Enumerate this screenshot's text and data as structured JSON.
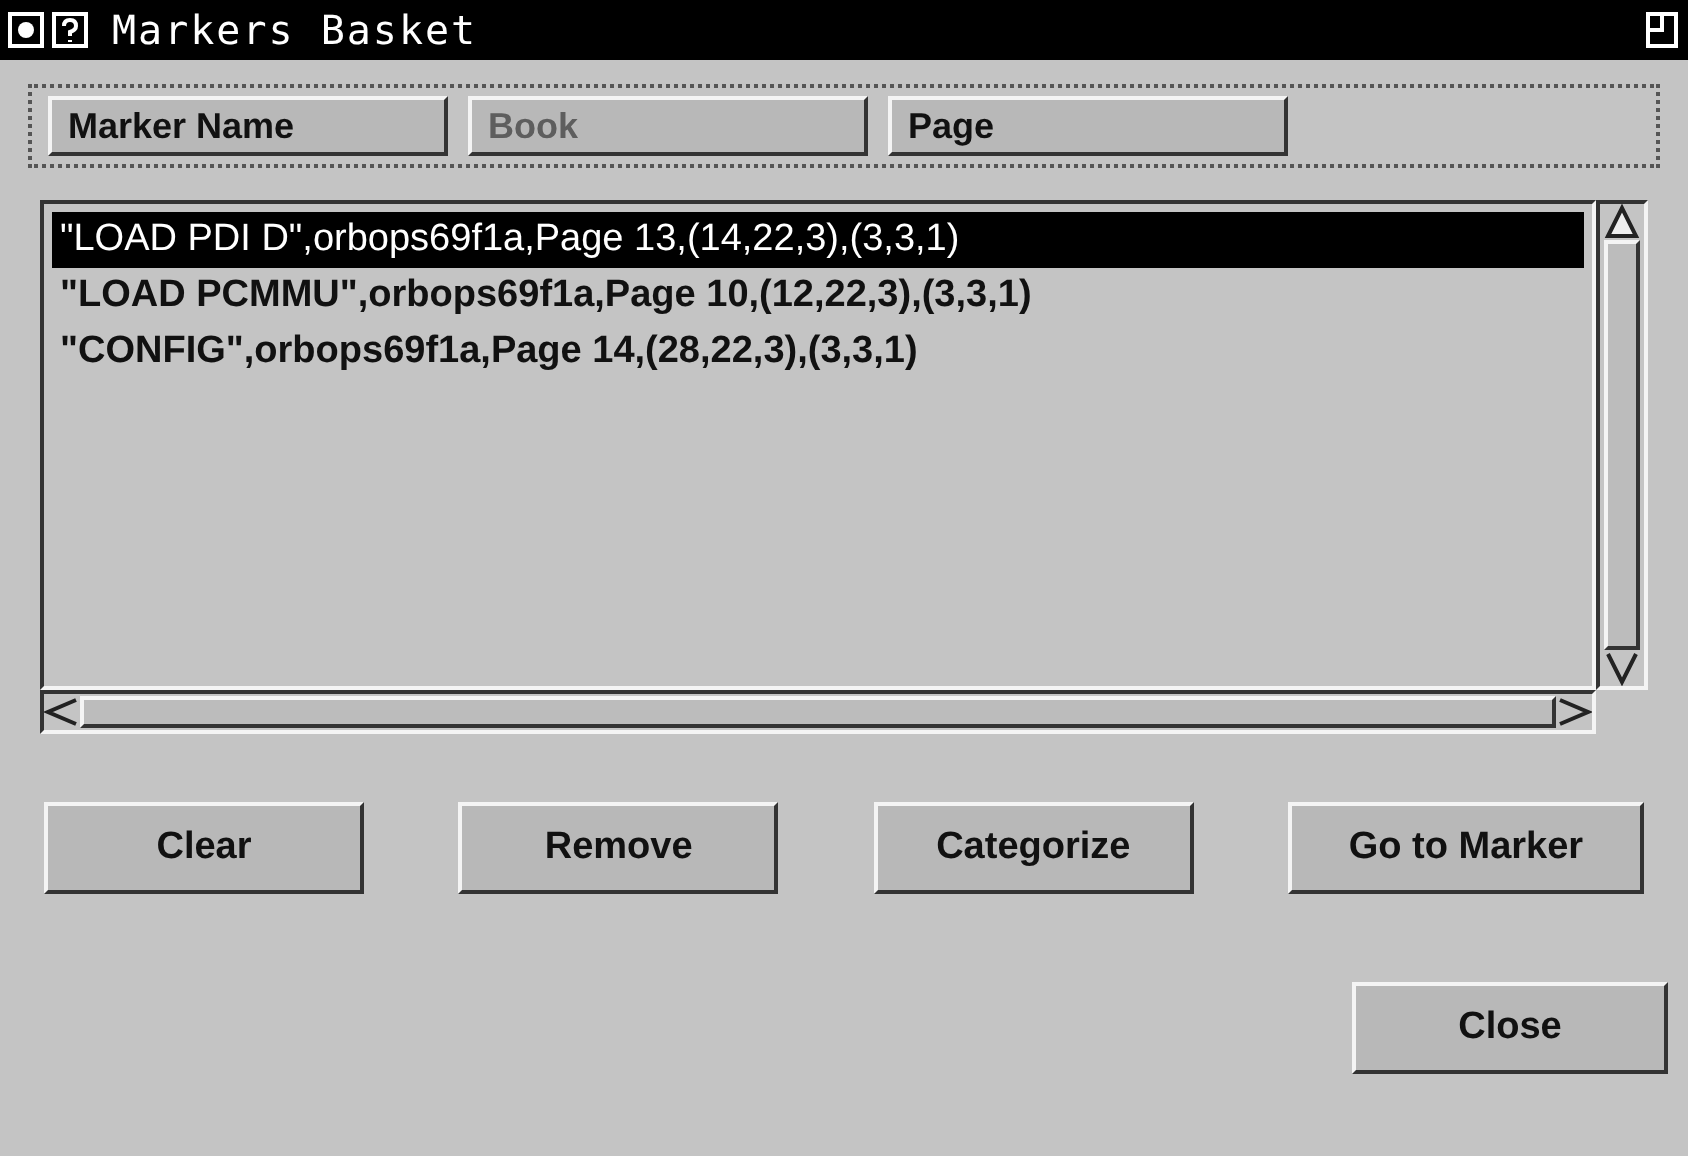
{
  "window": {
    "title": "Markers Basket"
  },
  "columns": [
    {
      "label": "Marker Name",
      "disabled": false
    },
    {
      "label": "Book",
      "disabled": true
    },
    {
      "label": "Page",
      "disabled": false
    }
  ],
  "markers": [
    {
      "text": "\"LOAD PDI D\",orbops69f1a,Page 13,(14,22,3),(3,3,1)",
      "selected": true
    },
    {
      "text": "\"LOAD PCMMU\",orbops69f1a,Page 10,(12,22,3),(3,3,1)",
      "selected": false
    },
    {
      "text": "\"CONFIG\",orbops69f1a,Page 14,(28,22,3),(3,3,1)",
      "selected": false
    }
  ],
  "buttons": [
    {
      "label": "Clear"
    },
    {
      "label": "Remove"
    },
    {
      "label": "Categorize"
    },
    {
      "label": "Go to Marker"
    }
  ],
  "close_button": {
    "label": "Close"
  }
}
